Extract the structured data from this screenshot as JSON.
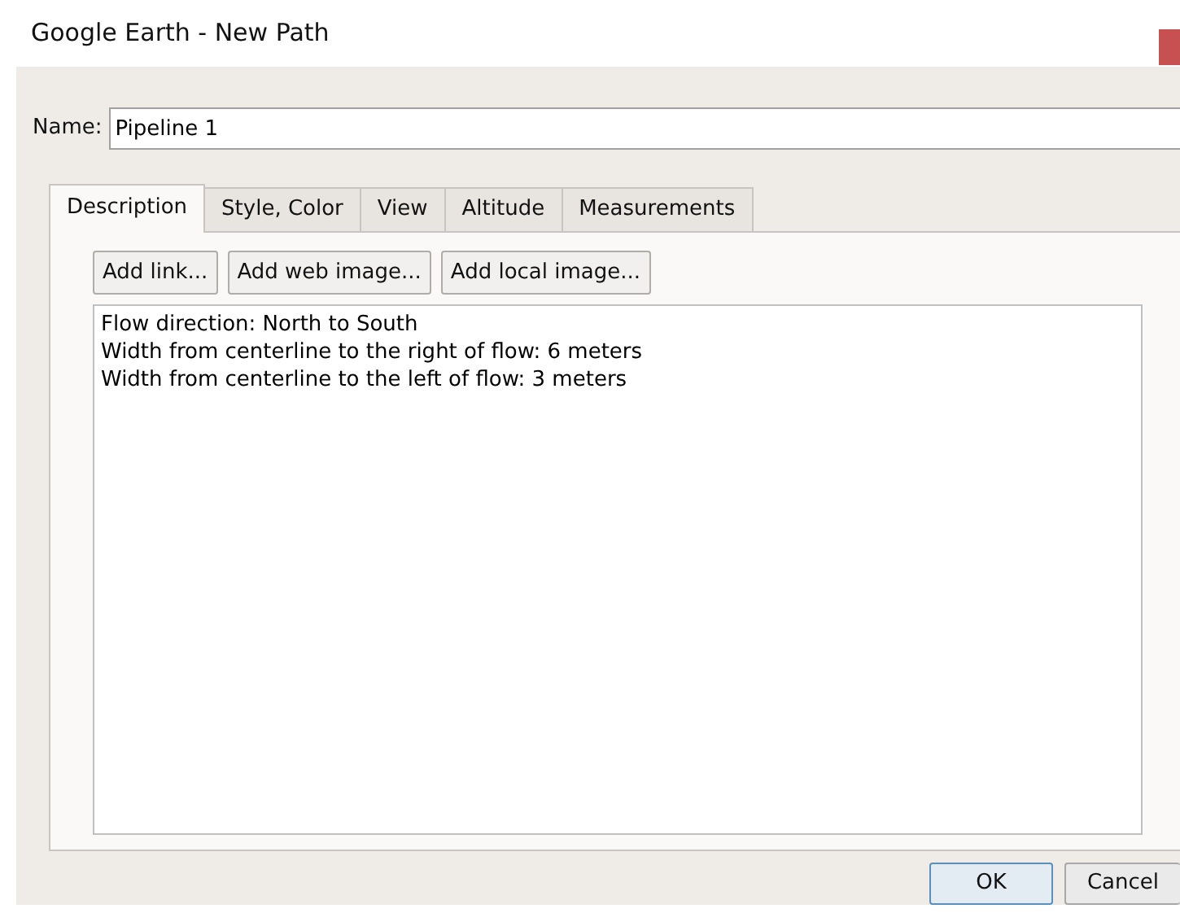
{
  "window": {
    "title": "Google Earth - New Path"
  },
  "name_field": {
    "label": "Name:",
    "value": "Pipeline 1"
  },
  "tabs": [
    {
      "label": "Description",
      "selected": true
    },
    {
      "label": "Style, Color",
      "selected": false
    },
    {
      "label": "View",
      "selected": false
    },
    {
      "label": "Altitude",
      "selected": false
    },
    {
      "label": "Measurements",
      "selected": false
    }
  ],
  "description_buttons": [
    "Add link...",
    "Add web image...",
    "Add local image..."
  ],
  "description_lines": [
    "Flow direction: North to South",
    "Width from centerline to the right of flow: 6 meters",
    "Width from centerline to the left of flow: 3 meters"
  ],
  "buttons": [
    {
      "label": "OK",
      "kind": "default"
    },
    {
      "label": "Cancel",
      "kind": "normal"
    }
  ]
}
